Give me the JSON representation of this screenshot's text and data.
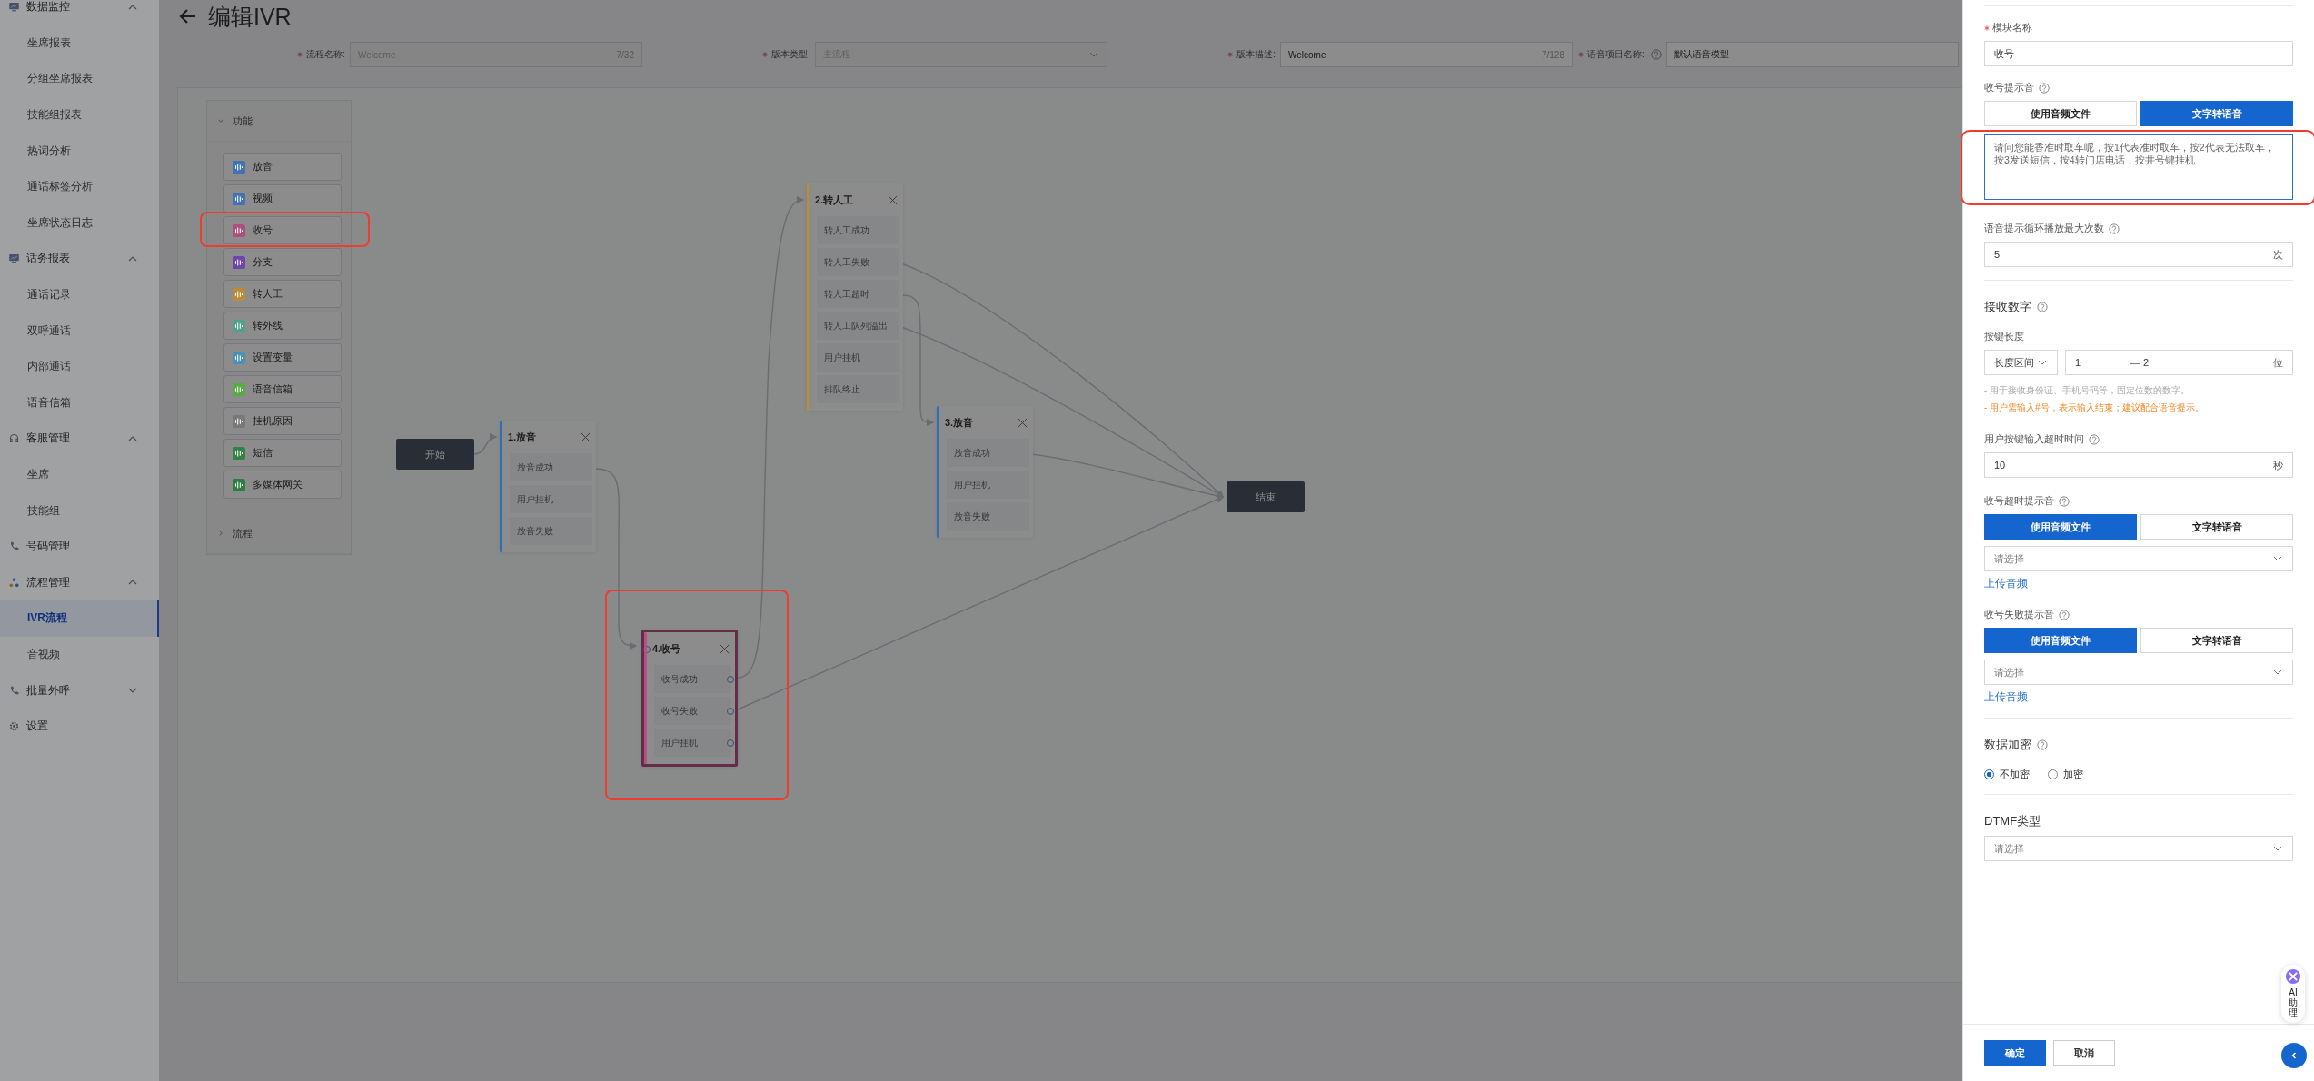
{
  "sidebar": {
    "items": [
      {
        "label": "数据监控",
        "expanded": true,
        "children": [
          {
            "label": "坐席报表",
            "selected": false
          },
          {
            "label": "分组坐席报表",
            "selected": false
          },
          {
            "label": "技能组报表",
            "selected": false
          },
          {
            "label": "热词分析",
            "selected": false
          },
          {
            "label": "通话标签分析",
            "selected": false
          },
          {
            "label": "坐席状态日志",
            "selected": false
          }
        ]
      },
      {
        "label": "话务报表",
        "expanded": true,
        "children": [
          {
            "label": "通话记录",
            "selected": false
          },
          {
            "label": "双呼通话",
            "selected": false
          },
          {
            "label": "内部通话",
            "selected": false
          },
          {
            "label": "语音信箱",
            "selected": false
          }
        ]
      },
      {
        "label": "客服管理",
        "expanded": true,
        "children": [
          {
            "label": "坐席",
            "selected": false
          },
          {
            "label": "技能组",
            "selected": false
          }
        ]
      },
      {
        "label": "号码管理"
      },
      {
        "label": "流程管理",
        "expanded": true,
        "children": [
          {
            "label": "IVR流程",
            "selected": true
          },
          {
            "label": "音视频",
            "selected": false
          }
        ]
      },
      {
        "label": "批量外呼",
        "expanded": false
      },
      {
        "label": "设置"
      }
    ]
  },
  "page": {
    "title": "编辑IVR"
  },
  "form": {
    "fields": [
      {
        "label": "流程名称:",
        "required": true,
        "kind": "input",
        "value": "Welcome",
        "counter": "7/32",
        "disabled": true
      },
      {
        "label": "版本类型:",
        "required": true,
        "kind": "select",
        "value": "主流程",
        "disabled": true
      },
      {
        "label": "版本描述:",
        "required": true,
        "kind": "input",
        "value": "Welcome",
        "counter": "7/128",
        "disabled": false
      },
      {
        "label": "语音项目名称:",
        "required": true,
        "help": true,
        "kind": "select",
        "value": "默认语音模型",
        "disabled": false
      }
    ]
  },
  "palette": {
    "sections": [
      {
        "title": "功能",
        "expanded": true,
        "items": [
          {
            "label": "放音",
            "color": "#4073af"
          },
          {
            "label": "视频",
            "color": "#4073af"
          },
          {
            "label": "收号",
            "color": "#aa507d"
          },
          {
            "label": "分支",
            "color": "#6e46aa"
          },
          {
            "label": "转人工",
            "color": "#b98c3c"
          },
          {
            "label": "转外线",
            "color": "#50a08c"
          },
          {
            "label": "设置变量",
            "color": "#4b91b4"
          },
          {
            "label": "语音信箱",
            "color": "#5aaa46"
          },
          {
            "label": "挂机原因",
            "color": "#787878"
          },
          {
            "label": "短信",
            "color": "#328246"
          },
          {
            "label": "多媒体网关",
            "color": "#2d7d41"
          }
        ]
      },
      {
        "title": "流程",
        "expanded": false
      }
    ]
  },
  "canvas": {
    "nodes": [
      {
        "kind": "terminal",
        "label": "开始"
      },
      {
        "kind": "module",
        "title": "1.放音",
        "color": "#326eb4",
        "selected": false,
        "ports": [
          "放音成功",
          "用户挂机",
          "放音失败"
        ]
      },
      {
        "kind": "module",
        "title": "2.转人工",
        "color": "#be8c32",
        "selected": false,
        "ports": [
          "转人工成功",
          "转人工失败",
          "转人工超时",
          "转人工队列溢出",
          "用户挂机",
          "排队终止"
        ]
      },
      {
        "kind": "module",
        "title": "3.放音",
        "color": "#326eb4",
        "selected": false,
        "ports": [
          "放音成功",
          "用户挂机",
          "放音失败"
        ]
      },
      {
        "kind": "module",
        "title": "4.收号",
        "color": "#b45082",
        "selected": true,
        "ports": [
          "收号成功",
          "收号失败",
          "用户挂机"
        ]
      },
      {
        "kind": "terminal",
        "label": "结束"
      }
    ]
  },
  "panel": {
    "module_name": {
      "label": "模块名称",
      "required": true,
      "value": "收号"
    },
    "prompt": {
      "label": "收号提示音",
      "modes": [
        {
          "label": "使用音频文件",
          "selected": false
        },
        {
          "label": "文字转语音",
          "selected": true
        }
      ],
      "text": "请问您能香准时取车呢，按1代表准时取车，按2代表无法取车，按3发送短信，按4转门店电话，按井号键挂机"
    },
    "max_loops": {
      "label": "语音提示循环播放最大次数",
      "value": "5",
      "unit": "次"
    },
    "receive": {
      "title": "接收数字",
      "key_length": {
        "label": "按键长度",
        "mode": "长度区间",
        "min": "1",
        "separator": "—",
        "max": "2",
        "unit": "位"
      },
      "hints": [
        {
          "text": "- 用于接收身份证、手机号码等，固定位数的数字。",
          "kind": "note"
        },
        {
          "text": "- 用户需输入#号，表示输入结束；建议配合语音提示。",
          "kind": "warning"
        }
      ],
      "timeout": {
        "label": "用户按键输入超时时间",
        "value": "10",
        "unit": "秒"
      }
    },
    "timeout_prompt": {
      "label": "收号超时提示音",
      "modes": [
        {
          "label": "使用音频文件",
          "selected": true
        },
        {
          "label": "文字转语音",
          "selected": false
        }
      ],
      "placeholder": "请选择",
      "link": "上传音频"
    },
    "fail_prompt": {
      "label": "收号失败提示音",
      "modes": [
        {
          "label": "使用音频文件",
          "selected": true
        },
        {
          "label": "文字转语音",
          "selected": false
        }
      ],
      "placeholder": "请选择",
      "link": "上传音频"
    },
    "encryption": {
      "title": "数据加密",
      "options": [
        {
          "label": "不加密",
          "selected": true
        },
        {
          "label": "加密",
          "selected": false
        }
      ]
    },
    "dtmf": {
      "title": "DTMF类型",
      "placeholder": "请选择"
    },
    "buttons": [
      {
        "label": "确定",
        "kind": "primary"
      },
      {
        "label": "取消",
        "kind": "default"
      }
    ]
  },
  "assistant": {
    "label": "AI助理"
  }
}
